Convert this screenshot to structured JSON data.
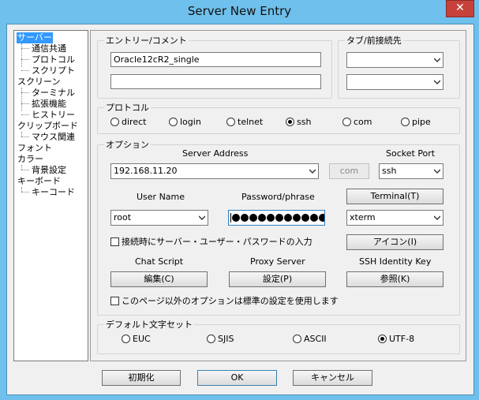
{
  "window": {
    "title": "Server New Entry",
    "close_glyph": "✕"
  },
  "tree": [
    {
      "label": "サーバー",
      "level": 0
    },
    {
      "label": "通信共通",
      "level": 1
    },
    {
      "label": "プロトコル",
      "level": 1
    },
    {
      "label": "スクリプト",
      "level": 1
    },
    {
      "label": "スクリーン",
      "level": 0
    },
    {
      "label": "ターミナル",
      "level": 1
    },
    {
      "label": "拡張機能",
      "level": 1
    },
    {
      "label": "ヒストリー",
      "level": 1
    },
    {
      "label": "クリップボード",
      "level": 0
    },
    {
      "label": "マウス関連",
      "level": 1
    },
    {
      "label": "フォント",
      "level": 0
    },
    {
      "label": "カラー",
      "level": 0
    },
    {
      "label": "背景設定",
      "level": 1
    },
    {
      "label": "キーボード",
      "level": 0
    },
    {
      "label": "キーコード",
      "level": 1
    }
  ],
  "entry": {
    "legend": "エントリー/コメント",
    "name_value": "Oracle12cR2_single",
    "comment_value": ""
  },
  "tab": {
    "legend": "タブ/前接続先",
    "tab_value": "",
    "prev_value": ""
  },
  "protocol": {
    "legend": "プロトコル",
    "options": [
      "direct",
      "login",
      "telnet",
      "ssh",
      "com",
      "pipe"
    ],
    "selected": "ssh"
  },
  "options": {
    "legend": "オプション",
    "server_address_label": "Server Address",
    "server_address_value": "192.168.11.20",
    "com_button": "com",
    "socket_port_label": "Socket Port",
    "socket_port_value": "ssh",
    "user_name_label": "User Name",
    "user_name_value": "root",
    "password_label": "Password/phrase",
    "password_masked_count": 11,
    "terminal_button": "Terminal(T)",
    "terminal_value": "xterm",
    "auto_login_check": "接続時にサーバー・ユーザー・パスワードの入力",
    "icon_button": "アイコン(I)",
    "chat_script_label": "Chat Script",
    "chat_script_button": "編集(C)",
    "proxy_server_label": "Proxy Server",
    "proxy_server_button": "設定(P)",
    "ssh_key_label": "SSH Identity Key",
    "ssh_key_button": "参照(K)",
    "default_options_check": "このページ以外のオプションは標準の設定を使用します"
  },
  "charset": {
    "legend": "デフォルト文字セット",
    "options": [
      "EUC",
      "SJIS",
      "ASCII",
      "UTF-8"
    ],
    "selected": "UTF-8"
  },
  "footer": {
    "init_button": "初期化",
    "ok_button": "OK",
    "cancel_button": "キャンセル"
  },
  "colors": {
    "title_bar": "#6fc0ec",
    "close_button": "#c7413b",
    "dialog_bg": "#f0f0f0"
  }
}
